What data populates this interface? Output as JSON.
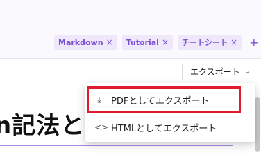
{
  "tags": [
    {
      "label": "Markdown",
      "remove": "×"
    },
    {
      "label": "Tutorial",
      "remove": "×"
    },
    {
      "label": "チートシート",
      "remove": "×"
    }
  ],
  "add_tag": "+",
  "toolbar": {
    "export_label": "エクスポート",
    "export_chevron": "⌄"
  },
  "heading": "n記法と書",
  "menu": {
    "items": [
      {
        "icon": "download-icon",
        "glyph": "⤓",
        "label": "PDFとしてエクスポート"
      },
      {
        "icon": "code-icon",
        "glyph": "<>",
        "label": "HTMLとしてエクスポート"
      }
    ]
  },
  "colors": {
    "accent": "#7b4fd6",
    "tag_bg": "#efe8fb",
    "highlight": "#e01b2c"
  }
}
